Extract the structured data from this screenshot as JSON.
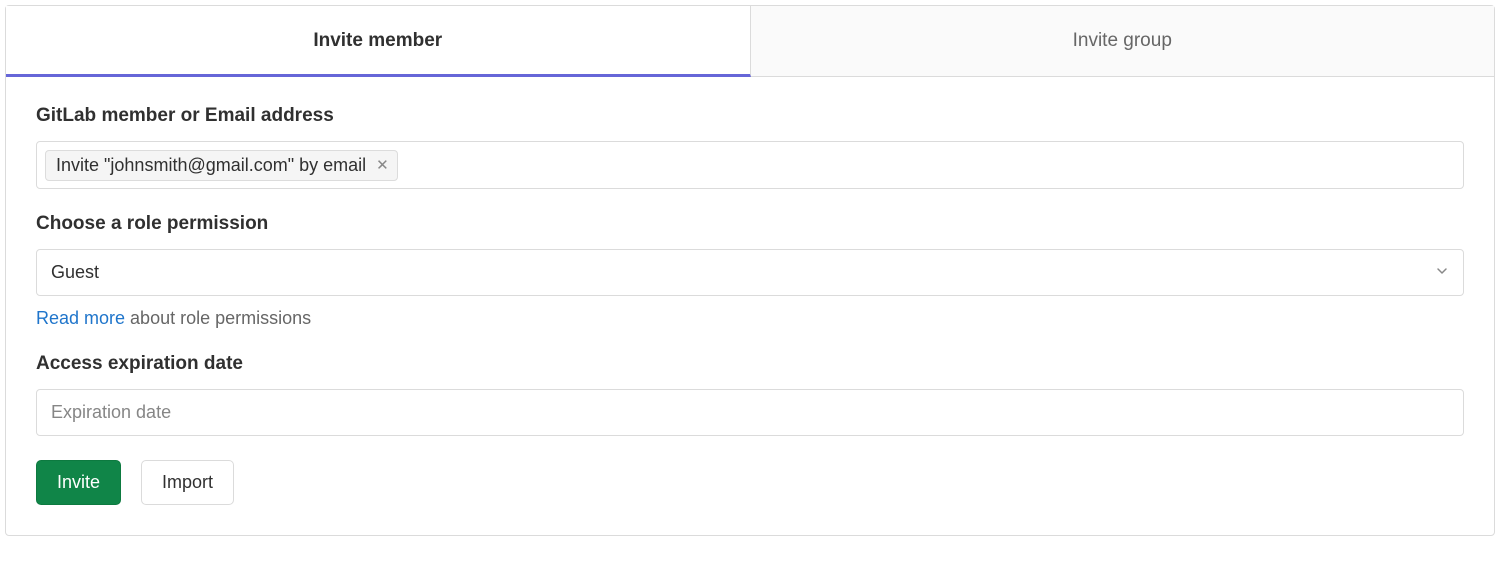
{
  "tabs": {
    "invite_member": "Invite member",
    "invite_group": "Invite group"
  },
  "member": {
    "label": "GitLab member or Email address",
    "token": "Invite \"johnsmith@gmail.com\" by email"
  },
  "role": {
    "label": "Choose a role permission",
    "selected": "Guest",
    "read_more": "Read more",
    "helper_suffix": " about role permissions"
  },
  "expiration": {
    "label": "Access expiration date",
    "placeholder": "Expiration date"
  },
  "buttons": {
    "invite": "Invite",
    "import": "Import"
  }
}
